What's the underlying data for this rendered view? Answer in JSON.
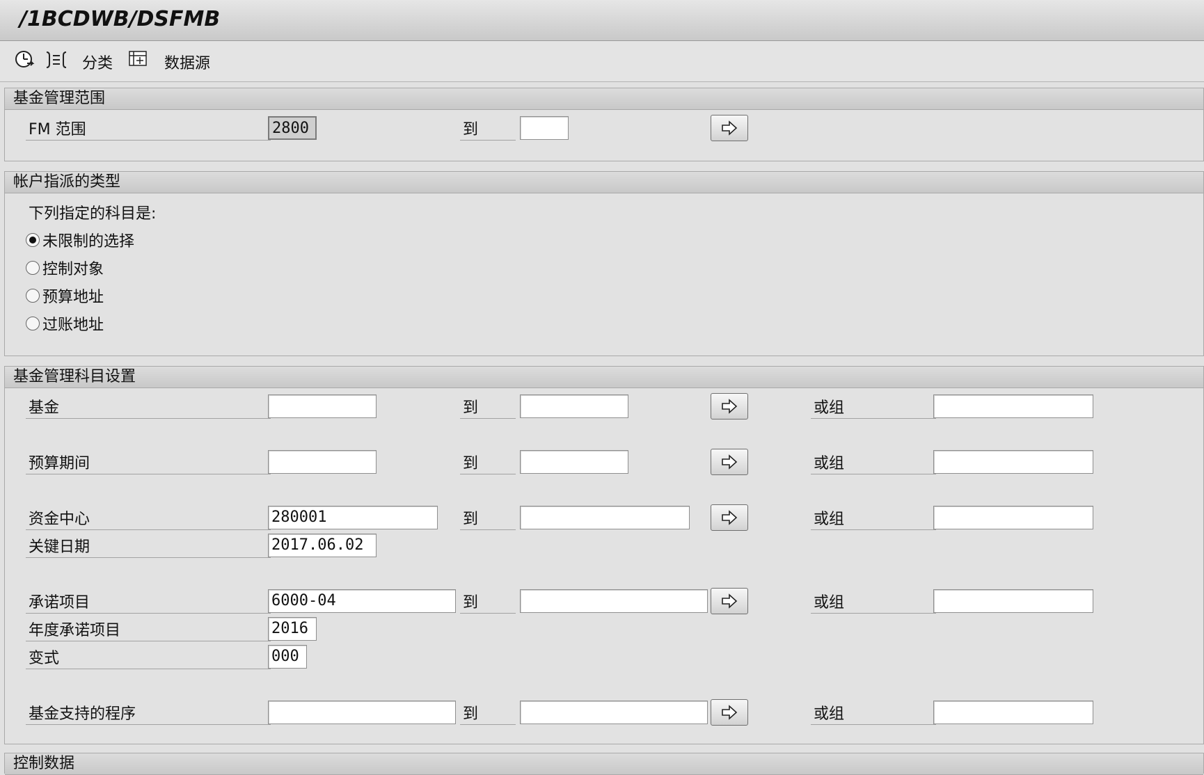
{
  "window": {
    "title": "/1BCDWB/DSFMB"
  },
  "toolbar": {
    "items": [
      {
        "icon": "clock-execute-icon"
      },
      {
        "icon": "expand-selection-icon"
      },
      {
        "label": "分类"
      },
      {
        "icon": "add-table-icon"
      },
      {
        "label": "数据源"
      }
    ]
  },
  "section_fm": {
    "header": "基金管理范围",
    "fm_area": {
      "label": "FM 范围",
      "from": "2800",
      "to_label": "到",
      "to": ""
    }
  },
  "section_account": {
    "header": "帐户指派的类型",
    "intro": "下列指定的科目是:",
    "options": [
      {
        "label": "未限制的选择",
        "selected": true
      },
      {
        "label": "控制对象",
        "selected": false
      },
      {
        "label": "预算地址",
        "selected": false
      },
      {
        "label": "过账地址",
        "selected": false
      }
    ]
  },
  "section_master": {
    "header": "基金管理科目设置",
    "to_label": "到",
    "or_group_label": "或组",
    "fund": {
      "label": "基金",
      "from": "",
      "to": "",
      "group": ""
    },
    "budget_period": {
      "label": "预算期间",
      "from": "",
      "to": "",
      "group": ""
    },
    "funds_center": {
      "label": "资金中心",
      "from": "280001",
      "to": "",
      "group": ""
    },
    "key_date": {
      "label": "关键日期",
      "value": "2017.06.02"
    },
    "commitment_item": {
      "label": "承诺项目",
      "from": "6000-04",
      "to": "",
      "group": ""
    },
    "fiscal_year_ci": {
      "label": "年度承诺项目",
      "value": "2016"
    },
    "variant": {
      "label": "变式",
      "value": "000"
    },
    "funded_program": {
      "label": "基金支持的程序",
      "from": "",
      "to": "",
      "group": ""
    }
  },
  "section_control": {
    "header": "控制数据"
  },
  "colors": {
    "background": "#e1e1e1",
    "header": "#c8c8c8",
    "input": "#ffffff"
  }
}
